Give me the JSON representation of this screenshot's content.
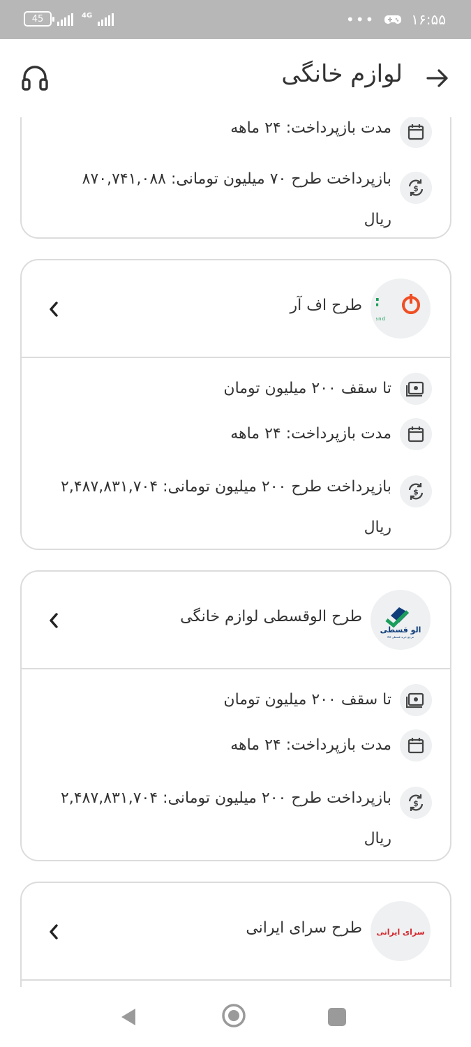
{
  "status_bar": {
    "time": "۱۶:۵۵",
    "battery": "45",
    "network": "4G",
    "dots": "•••"
  },
  "header": {
    "title": "لوازم خانگی"
  },
  "cards": [
    {
      "limit": "",
      "duration": "مدت بازپرداخت: ۲۴ ماهه",
      "repayment_line1": "بازپرداخت طرح ۷۰ میلیون تومانی: ۸۷۰,۷۴۱,۰۸۸",
      "repayment_line2": "ریال"
    },
    {
      "name": "طرح اف آر",
      "logo": "fr-logo",
      "logo_text": "F",
      "logo_sub": "rivand",
      "limit": "تا سقف  ۲۰۰ میلیون تومان",
      "duration": "مدت بازپرداخت: ۲۴ ماهه",
      "repayment_line1": "بازپرداخت طرح ۲۰۰ میلیون تومانی: ۲,۴۸۷,۸۳۱,۷۰۴",
      "repayment_line2": "ریال"
    },
    {
      "name": "طرح الوقسطی لوازم خانگی",
      "logo": "alo-ghesti-logo",
      "logo_text": "الو قسطی",
      "logo_sub": "مرجع خرید قسطی کالا",
      "limit": "تا سقف  ۲۰۰ میلیون تومان",
      "duration": "مدت بازپرداخت: ۲۴ ماهه",
      "repayment_line1": "بازپرداخت طرح ۲۰۰ میلیون تومانی: ۲,۴۸۷,۸۳۱,۷۰۴",
      "repayment_line2": "ریال"
    },
    {
      "name": "طرح سرای ایرانی",
      "logo": "saray-irani-logo",
      "logo_text": "سرای ایرانی"
    }
  ],
  "icons": {
    "back": "arrow-right-icon",
    "support": "headset-icon",
    "limit": "money-icon",
    "duration": "calendar-icon",
    "repayment": "refund-icon",
    "expand": "chevron-left-icon"
  },
  "colors": {
    "accent_green": "#1a9e5b",
    "accent_orange": "#f04e23",
    "alo_blue": "#0f3d7a",
    "saray_red": "#d3242a"
  }
}
